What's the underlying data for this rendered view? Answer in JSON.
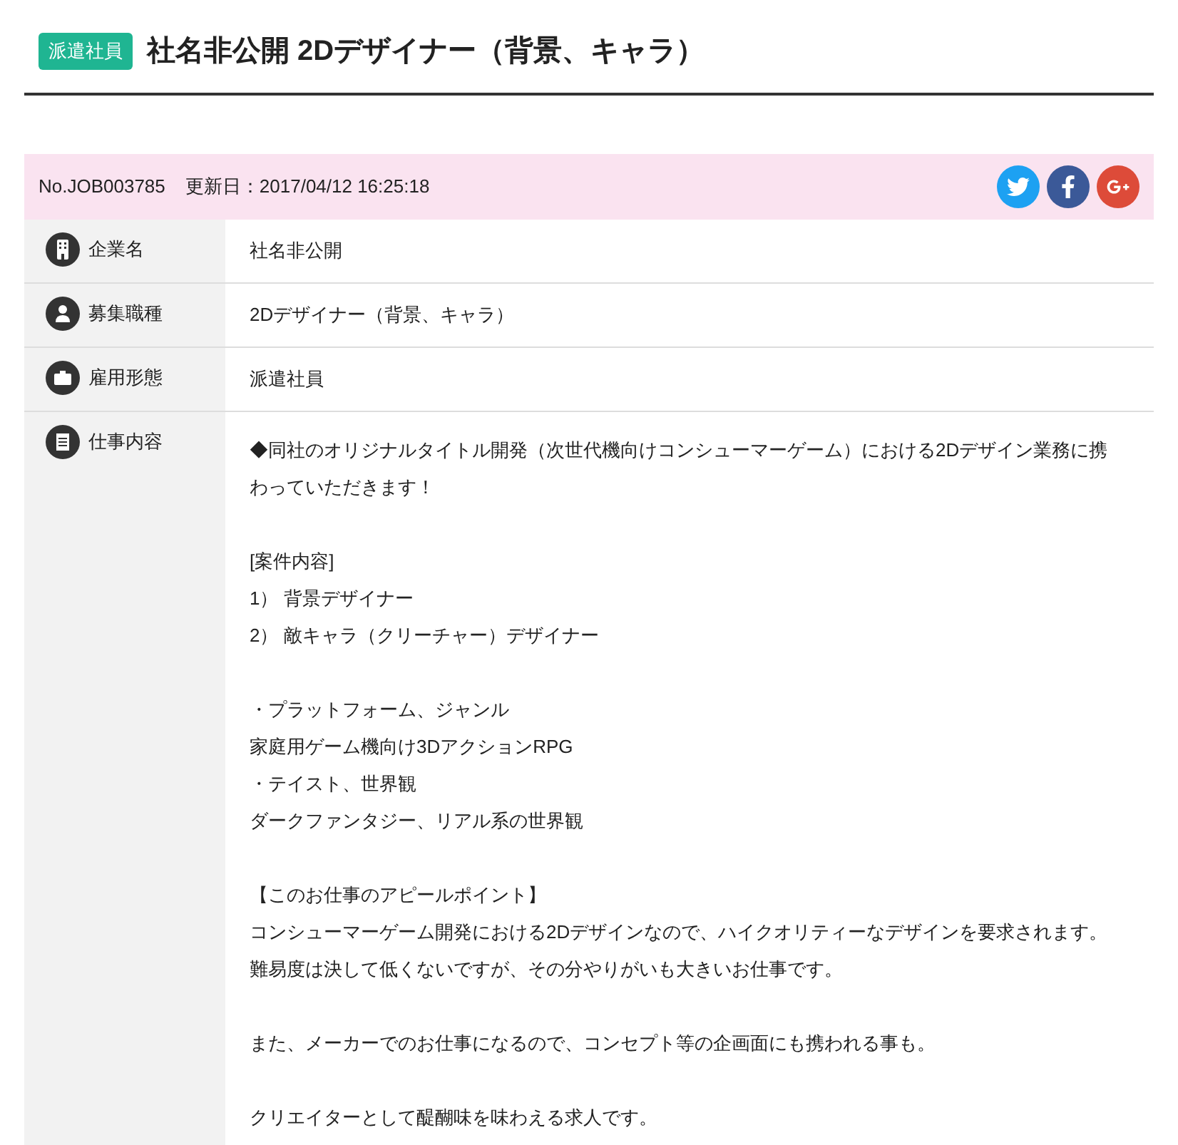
{
  "header": {
    "badge": "派遣社員",
    "title": "社名非公開 2Dデザイナー（背景、キャラ）"
  },
  "meta": {
    "job_no": "No.JOB003785",
    "updated": "更新日：2017/04/12 16:25:18"
  },
  "share_buttons": [
    {
      "kind": "twitter",
      "color": "#1da1f2"
    },
    {
      "kind": "facebook",
      "color": "#3b5998"
    },
    {
      "kind": "google_plus",
      "color": "#dd4b39"
    }
  ],
  "rows": [
    {
      "kind": "building",
      "label": "企業名",
      "value": [
        "社名非公開"
      ]
    },
    {
      "kind": "person",
      "label": "募集職種",
      "value": [
        "2Dデザイナー（背景、キャラ）"
      ]
    },
    {
      "kind": "briefcase",
      "label": "雇用形態",
      "value": [
        "派遣社員"
      ]
    },
    {
      "kind": "document",
      "label": "仕事内容",
      "blocks": [
        [
          "◆同社のオリジナルタイトル開発（次世代機向けコンシューマーゲーム）における2Dデザイン業務に携わっていただきます！"
        ],
        [
          "[案件内容]",
          "1） 背景デザイナー",
          "2） 敵キャラ（クリーチャー）デザイナー"
        ],
        [
          "・プラットフォーム、ジャンル",
          "家庭用ゲーム機向け3DアクションRPG",
          "・テイスト、世界観",
          "ダークファンタジー、リアル系の世界観"
        ],
        [
          "【このお仕事のアピールポイント】",
          "コンシューマーゲーム開発における2Dデザインなので、ハイクオリティーなデザインを要求されます。難易度は決して低くないですが、その分やりがいも大きいお仕事です。"
        ],
        [
          "また、メーカーでのお仕事になるので、コンセプト等の企画面にも携われる事も。"
        ],
        [
          "クリエイターとして醍醐味を味わえる求人です。"
        ]
      ]
    }
  ]
}
